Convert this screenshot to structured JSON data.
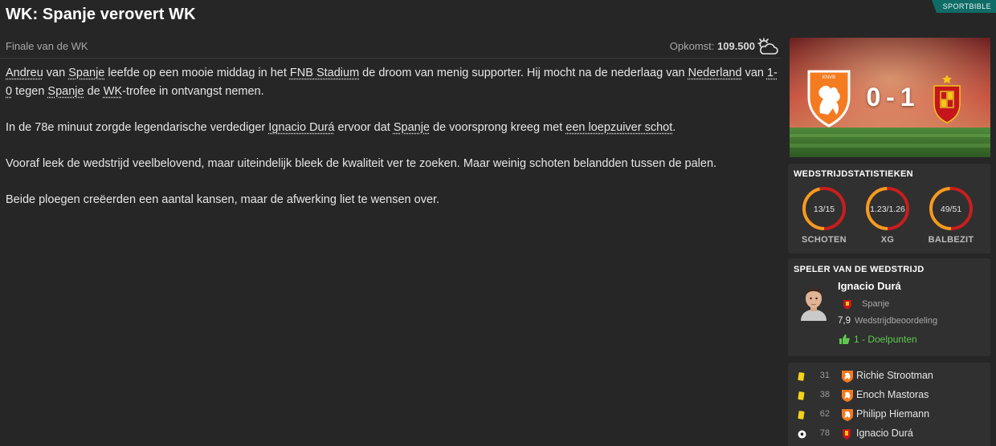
{
  "article": {
    "title": "WK: Spanje verovert WK",
    "source": "SPORTBIBLE",
    "subtitle": "Finale van de WK",
    "attendance_label": "Opkomst:",
    "attendance_value": "109.500",
    "paragraphs": [
      [
        {
          "t": "Andreu",
          "link": true
        },
        {
          "t": " van "
        },
        {
          "t": "Spanje",
          "link": true
        },
        {
          "t": " leefde op een mooie middag in het "
        },
        {
          "t": "FNB Stadium",
          "link": true
        },
        {
          "t": " de droom van menig supporter. Hij mocht na de nederlaag van "
        },
        {
          "t": "Nederland",
          "link": true
        },
        {
          "t": " van "
        },
        {
          "t": "1-0",
          "link": true
        },
        {
          "t": " tegen "
        },
        {
          "t": "Spanje",
          "link": true
        },
        {
          "t": " de "
        },
        {
          "t": "WK",
          "link": true
        },
        {
          "t": "-trofee in ontvangst nemen."
        }
      ],
      [
        {
          "t": "In de 78e minuut zorgde legendarische verdediger "
        },
        {
          "t": "Ignacio Durá",
          "link": true
        },
        {
          "t": " ervoor dat "
        },
        {
          "t": "Spanje",
          "link": true
        },
        {
          "t": " de voorsprong kreeg met "
        },
        {
          "t": "een loepzuiver schot",
          "link": true
        },
        {
          "t": "."
        }
      ],
      [
        {
          "t": "Vooraf leek de wedstrijd veelbelovend, maar uiteindelijk bleek de kwaliteit ver te zoeken. Maar weinig schoten belandden tussen de palen."
        }
      ],
      [
        {
          "t": "Beide ploegen creëerden een aantal kansen, maar de afwerking liet te wensen over."
        }
      ]
    ]
  },
  "match": {
    "score": "0 - 1",
    "home_team": "Nederland",
    "away_team": "Spanje",
    "home_color": "#f47b20",
    "away_color": "#c4161c"
  },
  "stats": {
    "title": "WEDSTRIJDSTATISTIEKEN",
    "items": [
      {
        "label": "SCHOTEN",
        "value": "13/15",
        "home": 13,
        "away": 15
      },
      {
        "label": "XG",
        "value": "1.23/1.26",
        "home": 1.23,
        "away": 1.26
      },
      {
        "label": "BALBEZIT",
        "value": "49/51",
        "home": 49,
        "away": 51
      }
    ],
    "home_color": "#f39c1f",
    "away_color": "#c81e1e"
  },
  "potm": {
    "title": "SPELER VAN DE WEDSTRIJD",
    "name": "Ignacio Durá",
    "team": "Spanje",
    "rating": "7,9",
    "rating_label": "Wedstrijdbeoordeling",
    "goals": "1 - Doelpunten"
  },
  "events": [
    {
      "type": "yellow-card",
      "minute": "31",
      "team": "Nederland",
      "player": "Richie Strootman"
    },
    {
      "type": "yellow-card",
      "minute": "38",
      "team": "Nederland",
      "player": "Enoch Mastoras"
    },
    {
      "type": "yellow-card",
      "minute": "62",
      "team": "Nederland",
      "player": "Philipp Hiemann"
    },
    {
      "type": "goal",
      "minute": "78",
      "team": "Spanje",
      "player": "Ignacio Durá"
    }
  ]
}
